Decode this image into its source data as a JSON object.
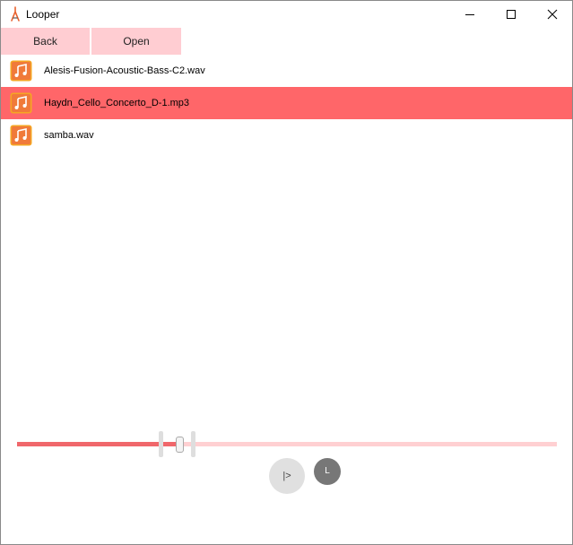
{
  "window": {
    "title": "Looper",
    "controls": [
      "minimize-icon",
      "maximize-icon",
      "close-icon"
    ]
  },
  "toolbar": {
    "back_label": "Back",
    "open_label": "Open",
    "button_color": "#ffcdd2"
  },
  "files": [
    {
      "name": "Alesis-Fusion-Acoustic-Bass-C2.wav",
      "icon": "music-file-icon",
      "selected": false
    },
    {
      "name": "Haydn_Cello_Concerto_D-1.mp3",
      "icon": "music-file-icon",
      "selected": true
    },
    {
      "name": "samba.wav",
      "icon": "music-file-icon",
      "selected": false
    }
  ],
  "player": {
    "play_label": "|>",
    "loop_label": "L",
    "progress": 0.3,
    "loop_start": 0.265,
    "loop_end": 0.325
  },
  "colors": {
    "accent": "#f0676b",
    "selection": "#ff6669",
    "track_background": "#ffd0d2",
    "play_button": "#e0e0e0",
    "loop_button": "#777777"
  }
}
